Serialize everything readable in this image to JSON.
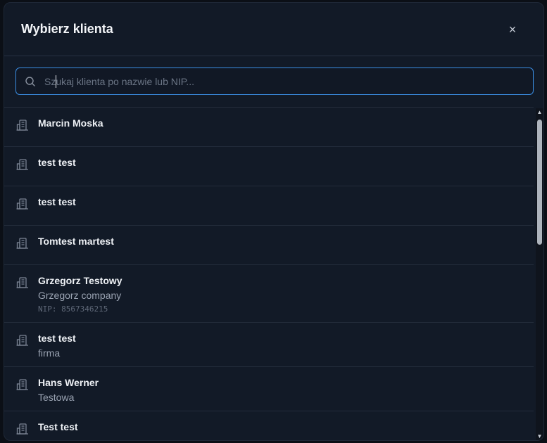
{
  "modal": {
    "title": "Wybierz klienta",
    "close_label": "×"
  },
  "search": {
    "placeholder": "Szukaj klienta po nazwie lub NIP...",
    "value": ""
  },
  "clients": [
    {
      "name": "Marcin Moska",
      "company": "",
      "nip": ""
    },
    {
      "name": "test test",
      "company": "",
      "nip": ""
    },
    {
      "name": "test test",
      "company": "",
      "nip": ""
    },
    {
      "name": "Tomtest martest",
      "company": "",
      "nip": ""
    },
    {
      "name": "Grzegorz Testowy",
      "company": "Grzegorz company",
      "nip": "NIP: 8567346215"
    },
    {
      "name": "test test",
      "company": "firma",
      "nip": ""
    },
    {
      "name": "Hans Werner",
      "company": "Testowa",
      "nip": ""
    },
    {
      "name": "Test test",
      "company": "",
      "nip": ""
    }
  ],
  "icons": {
    "search": "search-icon",
    "client": "building-icon",
    "close": "close-icon"
  },
  "colors": {
    "background": "#121a27",
    "accent": "#3a8de2",
    "text": "#eef1f5",
    "muted": "#9aa3b2"
  }
}
